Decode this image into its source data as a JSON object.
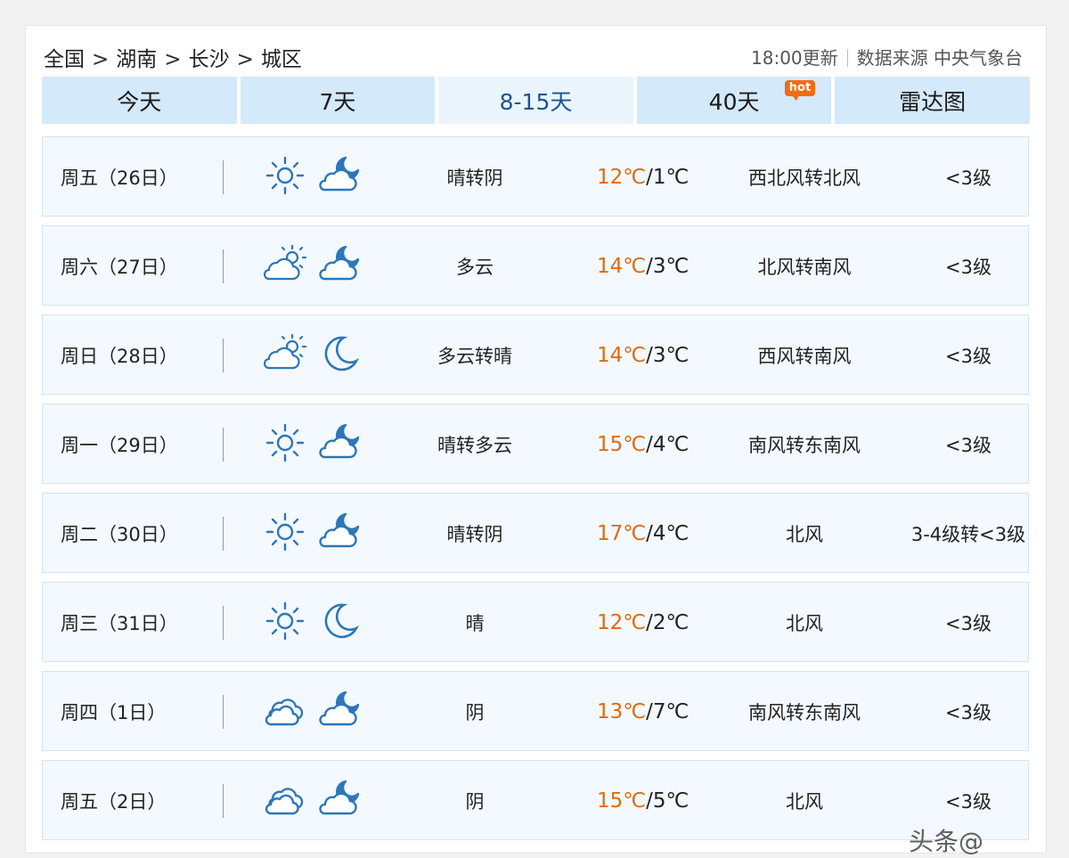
{
  "breadcrumb": {
    "items": [
      "全国",
      "湖南",
      "长沙",
      "城区"
    ],
    "separator": ">"
  },
  "update": {
    "time": "18:00更新",
    "source": "数据来源 中央气象台"
  },
  "tabs": [
    {
      "label": "今天",
      "active": false
    },
    {
      "label": "7天",
      "active": false
    },
    {
      "label": "8-15天",
      "active": true
    },
    {
      "label": "40天",
      "active": false,
      "badge": "hot"
    },
    {
      "label": "雷达图",
      "active": false
    }
  ],
  "forecast": [
    {
      "date": "周五（26日）",
      "day_icon": "sun-icon",
      "night_icon": "moon-cloud-icon",
      "desc": "晴转阴",
      "high": "12℃",
      "low": "/1℃",
      "wind": "西北风转北风",
      "level": "<3级"
    },
    {
      "date": "周六（27日）",
      "day_icon": "sun-cloud-icon",
      "night_icon": "moon-cloud-icon",
      "desc": "多云",
      "high": "14℃",
      "low": "/3℃",
      "wind": "北风转南风",
      "level": "<3级"
    },
    {
      "date": "周日（28日）",
      "day_icon": "sun-cloud-icon",
      "night_icon": "moon-icon",
      "desc": "多云转晴",
      "high": "14℃",
      "low": "/3℃",
      "wind": "西风转南风",
      "level": "<3级"
    },
    {
      "date": "周一（29日）",
      "day_icon": "sun-icon",
      "night_icon": "moon-cloud-icon",
      "desc": "晴转多云",
      "high": "15℃",
      "low": "/4℃",
      "wind": "南风转东南风",
      "level": "<3级"
    },
    {
      "date": "周二（30日）",
      "day_icon": "sun-icon",
      "night_icon": "moon-cloud-icon",
      "desc": "晴转阴",
      "high": "17℃",
      "low": "/4℃",
      "wind": "北风",
      "level": "3-4级转<3级"
    },
    {
      "date": "周三（31日）",
      "day_icon": "sun-icon",
      "night_icon": "moon-icon",
      "desc": "晴",
      "high": "12℃",
      "low": "/2℃",
      "wind": "北风",
      "level": "<3级"
    },
    {
      "date": "周四（1日）",
      "day_icon": "cloud-icon",
      "night_icon": "moon-cloud-icon",
      "desc": "阴",
      "high": "13℃",
      "low": "/7℃",
      "wind": "南风转东南风",
      "level": "<3级"
    },
    {
      "date": "周五（2日）",
      "day_icon": "cloud-icon",
      "night_icon": "moon-cloud-icon",
      "desc": "阴",
      "high": "15℃",
      "low": "/5℃",
      "wind": "北风",
      "level": "<3级"
    }
  ],
  "colors": {
    "accent": "#1b5592",
    "tab_bg": "#d4e9f9",
    "high_temp": "#e06b0e",
    "icon_stroke": "#2d77b8"
  },
  "watermark": "头条@"
}
